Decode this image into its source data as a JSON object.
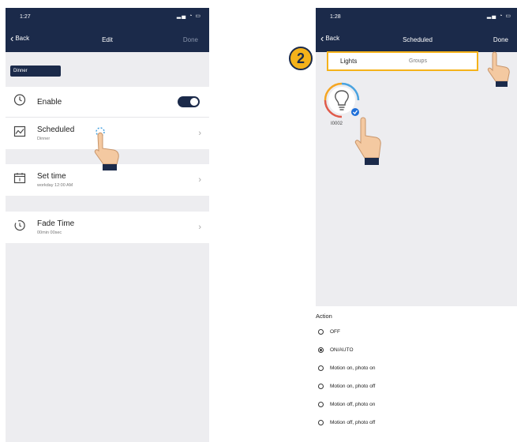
{
  "left_screen": {
    "time": "1:27",
    "back": "Back",
    "title": "Edit",
    "done": "Done",
    "name_tag": "Dinner",
    "enable": {
      "label": "Enable",
      "on": true
    },
    "scheduled": {
      "title": "Scheduled",
      "subtitle": "Dinner"
    },
    "set_time": {
      "title": "Set time",
      "subtitle": "workday 12:00 AM"
    },
    "fade_time": {
      "title": "Fade Time",
      "subtitle": "00min 00sec"
    }
  },
  "right_screen": {
    "time": "1:28",
    "back": "Back",
    "title": "Scheduled",
    "done": "Done",
    "step_number": "2",
    "tabs": [
      "Lights",
      "Groups"
    ],
    "device_label": "I0002",
    "action_heading": "Action",
    "options": [
      {
        "label": "OFF",
        "selected": false
      },
      {
        "label": "ON/AUTO",
        "selected": true
      },
      {
        "label": "Motion on, photo on",
        "selected": false
      },
      {
        "label": "Motion on, photo off",
        "selected": false
      },
      {
        "label": "Motion off, photo on",
        "selected": false
      },
      {
        "label": "Motion off, photo off",
        "selected": false
      }
    ]
  },
  "colors": {
    "navbar": "#1b2a4a",
    "highlight": "#f5b21a",
    "accent": "#1e6fd9"
  }
}
